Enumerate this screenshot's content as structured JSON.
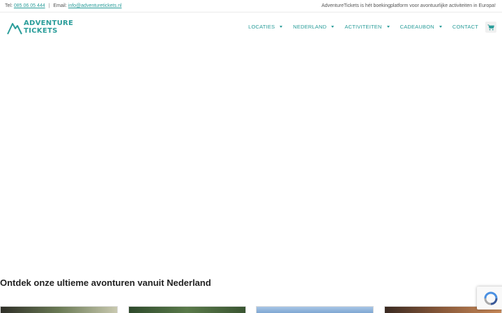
{
  "topbar": {
    "tel_label": "Tel:",
    "phone": "085 06 05 444",
    "email_label": "Email:",
    "email": "info@adventuretickets.nl",
    "tagline": "AdventureTickets is hét boekingplatform voor avontuurlijke activiteiten in Europa!"
  },
  "logo": {
    "line1": "ADVENTURE",
    "line2": "TICKETS"
  },
  "menu": {
    "items": [
      {
        "label": "LOCATIES"
      },
      {
        "label": "NEDERLAND"
      },
      {
        "label": "ACTIVITEITEN"
      },
      {
        "label": "CADEAUBON"
      },
      {
        "label": "CONTACT"
      }
    ]
  },
  "section": {
    "title": "Ontdek onze ultieme avonturen vanuit Nederland"
  },
  "colors": {
    "brand": "#2a9d9a",
    "card1": "#4a4a3e",
    "card2": "#3f5a3a",
    "card3": "#8fb3d9",
    "card4": "#6b4a3a"
  }
}
